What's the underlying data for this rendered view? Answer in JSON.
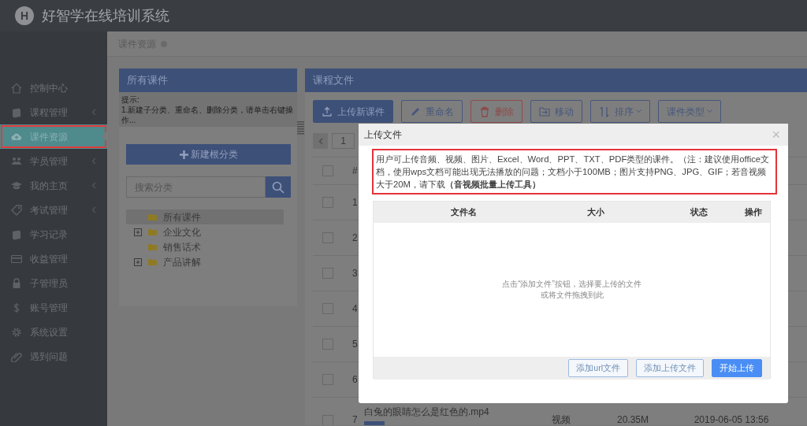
{
  "header": {
    "logo_letter": "H",
    "title": "好智学在线培训系统"
  },
  "sidebar": {
    "items": [
      {
        "label": "控制中心",
        "submenu": false,
        "selected": false,
        "highlighted": false
      },
      {
        "label": "课程管理",
        "submenu": true,
        "selected": false,
        "highlighted": false
      },
      {
        "label": "课件资源",
        "submenu": false,
        "selected": true,
        "highlighted": true
      },
      {
        "label": "学员管理",
        "submenu": true,
        "selected": false,
        "highlighted": false
      },
      {
        "label": "我的主页",
        "submenu": true,
        "selected": false,
        "highlighted": false
      },
      {
        "label": "考试管理",
        "submenu": true,
        "selected": false,
        "highlighted": false
      },
      {
        "label": "学习记录",
        "submenu": false,
        "selected": false,
        "highlighted": false
      },
      {
        "label": "收益管理",
        "submenu": false,
        "selected": false,
        "highlighted": false
      },
      {
        "label": "子管理员",
        "submenu": false,
        "selected": false,
        "highlighted": false
      },
      {
        "label": "账号管理",
        "submenu": false,
        "selected": false,
        "highlighted": false
      },
      {
        "label": "系统设置",
        "submenu": false,
        "selected": false,
        "highlighted": false
      },
      {
        "label": "遇到问题",
        "submenu": false,
        "selected": false,
        "highlighted": false
      }
    ]
  },
  "breadcrumb": "课件资源",
  "category_panel": {
    "title": "所有课件",
    "hint": [
      "提示:",
      "1.新建子分类、重命名、删除分类，请单击右键操作..."
    ],
    "new_button": "新建根分类",
    "search": {
      "placeholder": "搜索分类"
    },
    "tree": [
      {
        "label": "所有课件",
        "expandable": false,
        "selected": true
      },
      {
        "label": "企业文化",
        "expandable": true,
        "selected": false
      },
      {
        "label": "销售话术",
        "expandable": false,
        "selected": false
      },
      {
        "label": "产品讲解",
        "expandable": true,
        "selected": false
      }
    ]
  },
  "files_panel": {
    "title": "课程文件",
    "toolbar": [
      {
        "label": "上传新课件",
        "kind": "upload"
      },
      {
        "label": "重命名",
        "kind": "rename"
      },
      {
        "label": "删除",
        "kind": "delete"
      },
      {
        "label": "移动",
        "kind": "move"
      },
      {
        "label": "排序",
        "kind": "sort"
      },
      {
        "label": "课件类型",
        "kind": "filter"
      }
    ],
    "page": "1",
    "table": {
      "index_header": "#",
      "all_checked": false,
      "rows": [
        {
          "index": "1",
          "checked": false
        },
        {
          "index": "2",
          "checked": false
        },
        {
          "index": "3",
          "checked": false
        },
        {
          "index": "4",
          "checked": false
        },
        {
          "index": "5",
          "checked": false
        },
        {
          "index": "6",
          "checked": false
        },
        {
          "index": "7",
          "checked": false,
          "name": "白兔的眼睛怎么是红色的.mp4",
          "type": "视频",
          "size": "20.35M",
          "date": "2019-06-05 13:56",
          "tagged": true
        }
      ]
    }
  },
  "modal": {
    "title": "上传文件",
    "close": "×",
    "highlighted": true,
    "notice": "用户可上传音频、视频、图片、Excel、Word、PPT、TXT、PDF类型的课件。（注：建议使用office文档，使用wps文档可能出现无法播放的问题；文档小于100MB；图片支持PNG、JPG、GIF；若音视频大于20M，请下载**（音视频批量上传工具）**",
    "columns": [
      "文件名",
      "大小",
      "状态",
      "操作"
    ],
    "empty_hint": [
      "点击“添加文件”按钮，选择要上传的文件",
      "或将文件拖拽到此"
    ],
    "buttons": [
      {
        "label": "添加url文件",
        "primary": false
      },
      {
        "label": "添加上传文件",
        "primary": false
      },
      {
        "label": "开始上传",
        "primary": true
      }
    ]
  }
}
